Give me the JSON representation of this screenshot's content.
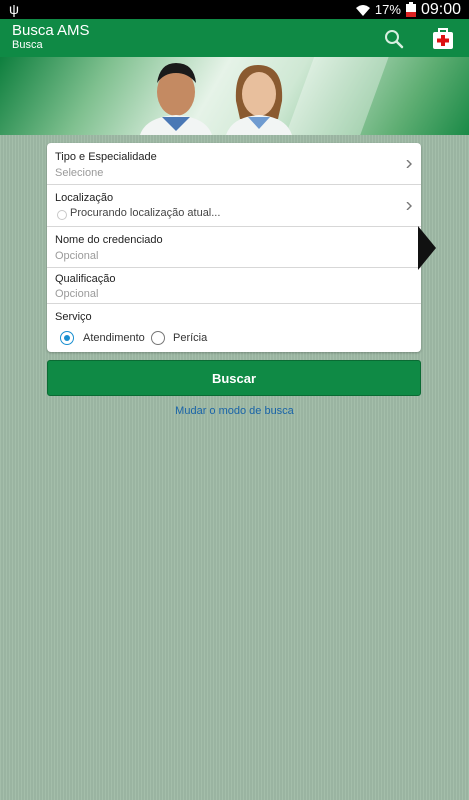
{
  "status_bar": {
    "battery_percent": "17%",
    "time": "09:00"
  },
  "action_bar": {
    "title": "Busca AMS",
    "subtitle": "Busca"
  },
  "form": {
    "tipo": {
      "label": "Tipo e Especialidade",
      "value": "Selecione"
    },
    "localizacao": {
      "label": "Localização",
      "value": "Procurando localização atual..."
    },
    "nome": {
      "label": "Nome do credenciado",
      "placeholder": "Opcional"
    },
    "qualificacao": {
      "label": "Qualificação",
      "placeholder": "Opcional"
    },
    "servico": {
      "label": "Serviço",
      "options": [
        "Atendimento",
        "Perícia"
      ],
      "selected": "Atendimento"
    }
  },
  "buscar_label": "Buscar",
  "modo_link": "Mudar o modo de busca",
  "colors": {
    "primary_green": "#0f8a45",
    "background": "#9fbaa6",
    "link_blue": "#1a64a8",
    "radio_blue": "#1a8fd0"
  }
}
